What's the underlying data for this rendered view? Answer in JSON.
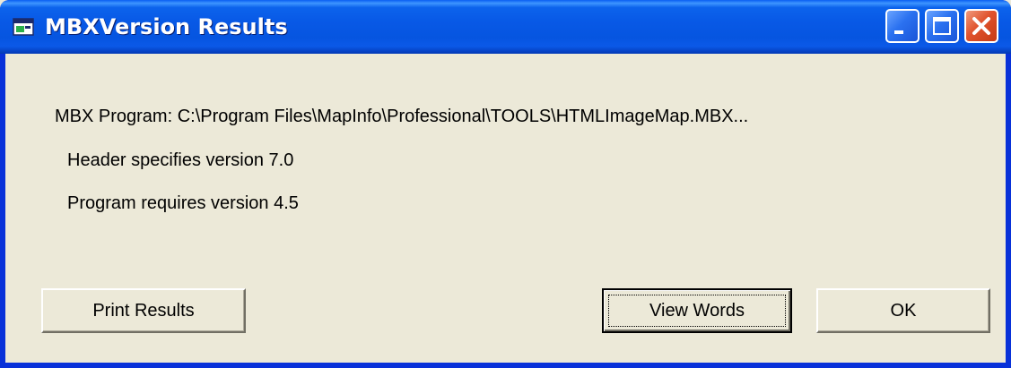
{
  "window": {
    "title": "MBXVersion Results",
    "icon": "app-window-icon",
    "controls": {
      "minimize_icon": "minimize-icon",
      "maximize_icon": "maximize-icon",
      "close_icon": "close-icon"
    }
  },
  "results": {
    "program_line": "MBX Program: C:\\Program Files\\MapInfo\\Professional\\TOOLS\\HTMLImageMap.MBX...",
    "header_line": "Header specifies version 7.0",
    "requires_line": "Program requires version 4.5"
  },
  "buttons": {
    "print_label": "Print Results",
    "view_words_label": "View Words",
    "ok_label": "OK"
  },
  "colors": {
    "titlebar": "#0054e3",
    "client_bg": "#ece9d8",
    "close_button": "#e0522c"
  }
}
